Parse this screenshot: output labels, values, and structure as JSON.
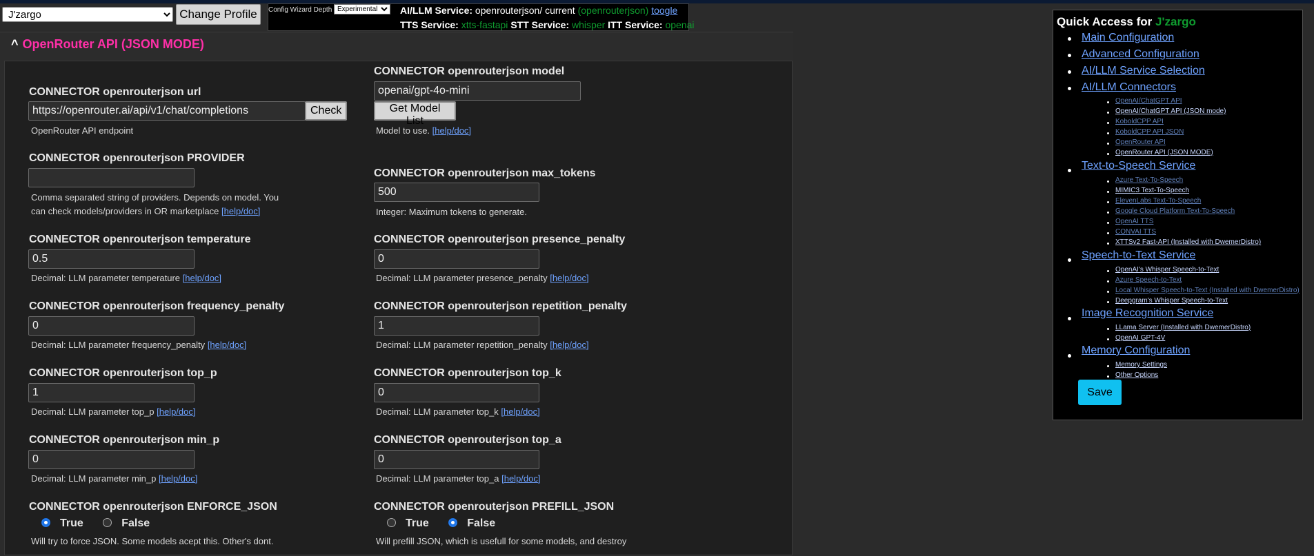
{
  "top": {
    "profile_selected": "J'zargo",
    "change_profile_label": "Change Profile",
    "wizard_label": "Config Wizard Depth",
    "wizard_selected": "Experimental",
    "ai_label": "AI/LLM Service:",
    "ai_value": "openrouterjson/ current",
    "ai_highlight": "(openrouterjson)",
    "toggle_link": "toogle",
    "tts_label": "TTS Service:",
    "tts_value": "xtts-fastapi",
    "stt_label": "STT Service:",
    "stt_value": "whisper",
    "itt_label": "ITT Service:",
    "itt_value": "openai"
  },
  "section": {
    "caret": "^",
    "title": "OpenRouter API (JSON MODE)"
  },
  "fields": {
    "url": {
      "title": "CONNECTOR openrouterjson url",
      "value": "https://openrouter.ai/api/v1/chat/completions",
      "button": "Check",
      "desc": "OpenRouter API endpoint"
    },
    "model": {
      "title": "CONNECTOR openrouterjson model",
      "value": "openai/gpt-4o-mini",
      "button": "Get Model List",
      "desc": "Model to use.",
      "link": "[help/doc]"
    },
    "provider": {
      "title": "CONNECTOR openrouterjson PROVIDER",
      "value": "",
      "desc1": "Comma separated string of providers. Depends on model. You",
      "desc2": "can check models/providers in OR marketplace",
      "link": "[help/doc]"
    },
    "max_tokens": {
      "title": "CONNECTOR openrouterjson max_tokens",
      "value": "500",
      "desc": "Integer: Maximum tokens to generate."
    },
    "temperature": {
      "title": "CONNECTOR openrouterjson temperature",
      "value": "0.5",
      "desc": "Decimal: LLM parameter temperature",
      "link": "[help/doc]"
    },
    "presence_penalty": {
      "title": "CONNECTOR openrouterjson presence_penalty",
      "value": "0",
      "desc": "Decimal: LLM parameter presence_penalty",
      "link": "[help/doc]"
    },
    "frequency_penalty": {
      "title": "CONNECTOR openrouterjson frequency_penalty",
      "value": "0",
      "desc": "Decimal: LLM parameter frequency_penalty",
      "link": "[help/doc]"
    },
    "repetition_penalty": {
      "title": "CONNECTOR openrouterjson repetition_penalty",
      "value": "1",
      "desc": "Decimal: LLM parameter repetition_penalty",
      "link": "[help/doc]"
    },
    "top_p": {
      "title": "CONNECTOR openrouterjson top_p",
      "value": "1",
      "desc": "Decimal: LLM parameter top_p",
      "link": "[help/doc]"
    },
    "top_k": {
      "title": "CONNECTOR openrouterjson top_k",
      "value": "0",
      "desc": "Decimal: LLM parameter top_k",
      "link": "[help/doc]"
    },
    "min_p": {
      "title": "CONNECTOR openrouterjson min_p",
      "value": "0",
      "desc": "Decimal: LLM parameter min_p",
      "link": "[help/doc]"
    },
    "top_a": {
      "title": "CONNECTOR openrouterjson top_a",
      "value": "0",
      "desc": "Decimal: LLM parameter top_a",
      "link": "[help/doc]"
    },
    "enforce_json": {
      "title": "CONNECTOR openrouterjson ENFORCE_JSON",
      "opt_true": "True",
      "opt_false": "False",
      "selected": "True",
      "desc": "Will try to force JSON. Some models acept this. Other's dont."
    },
    "prefill_json": {
      "title": "CONNECTOR openrouterjson PREFILL_JSON",
      "opt_true": "True",
      "opt_false": "False",
      "selected": "False",
      "desc": "Will prefill JSON, which is usefull for some models, and destroy"
    }
  },
  "quick_access": {
    "title": "Quick Access for",
    "name": "J'zargo",
    "sections": [
      {
        "label": "Main Configuration",
        "items": []
      },
      {
        "label": "Advanced Configuration",
        "items": []
      },
      {
        "label": "AI/LLM Service Selection",
        "items": []
      },
      {
        "label": "AI/LLM Connectors",
        "items": [
          "OpenAI/ChatGPT API",
          "OpenAI/ChatGPT API (JSON mode)",
          "KoboldCPP API",
          "KoboldCPP API JSON",
          "OpenRouter API",
          "OpenRouter API (JSON MODE)"
        ]
      },
      {
        "label": "Text-to-Speech Service",
        "items": [
          "Azure Text-To-Speech",
          "MIMIC3 Text-To-Speech",
          "ElevenLabs Text-To-Speech",
          "Google Cloud Platform Text-To-Speech",
          "OpenAI TTS",
          "CONVAI TTS",
          "XTTSv2 Fast-API (Installed with DwemerDistro)"
        ]
      },
      {
        "label": "Speech-to-Text Service",
        "items": [
          "OpenAI's Whisper Speech-to-Text",
          "Azure Speech-to-Text",
          "Local Whisper Speech-to-Text (Installed with DwemerDistro)",
          "Deepgram's Whisper Speech-to-Text"
        ]
      },
      {
        "label": "Image Recognition Service",
        "items": [
          "LLama Server (Installed with DwemerDistro)",
          "OpenAI GPT-4V"
        ]
      },
      {
        "label": "Memory Configuration",
        "items": [
          "Memory Settings",
          "Other Options"
        ]
      }
    ],
    "save_label": "Save"
  }
}
